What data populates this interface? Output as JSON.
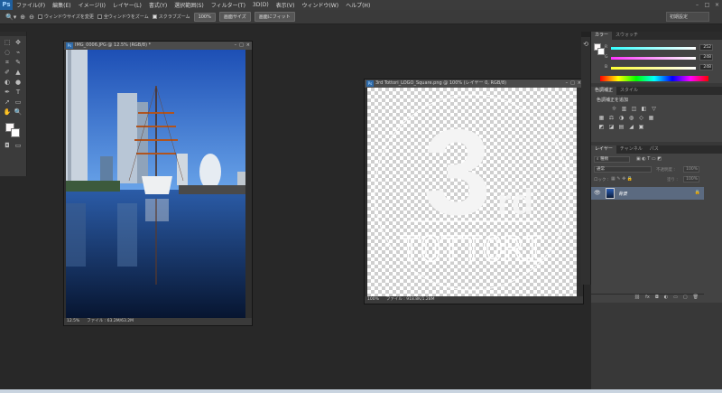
{
  "app": {
    "logo": "Ps"
  },
  "menu": [
    "ファイル(F)",
    "編集(E)",
    "イメージ(I)",
    "レイヤー(L)",
    "書式(Y)",
    "選択範囲(S)",
    "フィルター(T)",
    "3D(D)",
    "表示(V)",
    "ウィンドウ(W)",
    "ヘルプ(H)"
  ],
  "window_controls": {
    "minimize": "–",
    "maximize": "□",
    "close": "×"
  },
  "options": {
    "resize_windows": "ウィンドウサイズを変更",
    "zoom_all": "全ウィンドウをズーム",
    "scrubby_zoom": "スクラブズーム",
    "zoom_value": "100%",
    "fit_screen": "画面サイズ",
    "fill_screen": "画面にフィット",
    "workspace": "初期設定"
  },
  "tools": [
    "⬚",
    "✥",
    "◌",
    "⌁",
    "⌗",
    "✎",
    "✐",
    "▲",
    "◐",
    "●",
    "✒",
    "T",
    "➚",
    "▭",
    "✋",
    "🔍"
  ],
  "doc1": {
    "title": "IMG_0006.JPG @ 12.5% (RGB/8) *",
    "zoom": "12.5%",
    "file_info": "ファイル : 63.2M/63.2M"
  },
  "doc2": {
    "title": "3rd Tottori_LOGO_Square.png @ 100% (レイヤー 0, RGB/8)",
    "zoom": "100%",
    "file_info": "ファイル : 918.8K/1.28M",
    "logo_number": "3",
    "logo_suffix": "rd",
    "logo_word": "TOTTORI"
  },
  "panel_color": {
    "tabs": [
      "カラー",
      "スウォッチ"
    ],
    "channels": [
      {
        "label": "R",
        "value": "252",
        "color": "#ff4d4d"
      },
      {
        "label": "G",
        "value": "248",
        "color": "#6cff6c"
      },
      {
        "label": "B",
        "value": "248",
        "color": "#6c6cff"
      }
    ]
  },
  "panel_adjust": {
    "tabs": [
      "色調補正",
      "スタイル"
    ],
    "heading": "色調補正を追加",
    "row1": [
      "☼",
      "▥",
      "◫",
      "◧",
      "▽"
    ],
    "row2": [
      "▦",
      "⚖",
      "◑",
      "◍",
      "◇",
      "▦"
    ],
    "row3": [
      "◩",
      "◪",
      "▤",
      "◢",
      "▣"
    ]
  },
  "panel_layers": {
    "tabs": [
      "レイヤー",
      "チャンネル",
      "パス"
    ],
    "filter": "種類",
    "blend_mode": "通常",
    "opacity_label": "不透明度 :",
    "opacity": "100%",
    "lock_label": "ロック :",
    "fill_label": "塗り :",
    "fill": "100%",
    "layer_name": "背景",
    "bottom_icons": [
      "⛓",
      "fx",
      "◘",
      "◐",
      "▭",
      "▢",
      "🗑"
    ]
  }
}
